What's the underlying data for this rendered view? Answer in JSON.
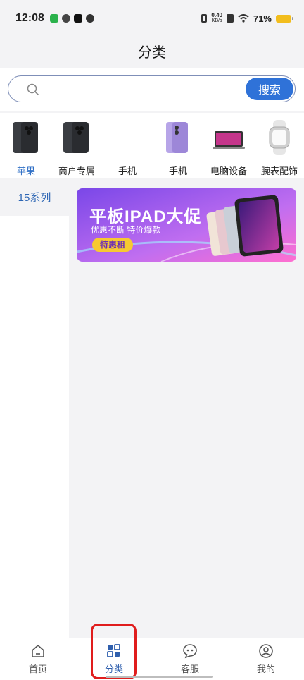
{
  "status_bar": {
    "time": "12:08",
    "net_speed_value": "0.40",
    "net_speed_unit": "KB/s",
    "battery": "71%",
    "icons": [
      "app-icon-green",
      "wechat-icon",
      "tiktok-icon",
      "link-icon",
      "vibrate-icon",
      "sim-icon",
      "wifi-icon",
      "battery-icon"
    ]
  },
  "header": {
    "title": "分类"
  },
  "search": {
    "placeholder": "",
    "value": "",
    "button_label": "搜索"
  },
  "categories": [
    {
      "label": "苹果",
      "icon": "iphone-pro-icon",
      "active": true
    },
    {
      "label": "商户专属",
      "icon": "iphone-pro-icon",
      "active": false
    },
    {
      "label": "手机",
      "icon": "blank",
      "active": false
    },
    {
      "label": "手机",
      "icon": "iphone-purple-icon",
      "active": false
    },
    {
      "label": "电脑设备",
      "icon": "laptop-icon",
      "active": false
    },
    {
      "label": "腕表配饰",
      "icon": "watch-icon",
      "active": false
    }
  ],
  "left_menu": {
    "items": [
      {
        "label": "15系列",
        "active": true
      }
    ]
  },
  "banner": {
    "title": "平板IPAD大促",
    "subtitle": "优惠不断 特价爆款",
    "badge": "特惠租",
    "colors": {
      "start": "#7a47e8",
      "end": "#ff6fd0",
      "badge": "#f7c932"
    }
  },
  "bottom_nav": {
    "items": [
      {
        "label": "首页",
        "icon": "home-icon",
        "active": false
      },
      {
        "label": "分类",
        "icon": "category-icon",
        "active": true
      },
      {
        "label": "客服",
        "icon": "chat-icon",
        "active": false
      },
      {
        "label": "我的",
        "icon": "profile-icon",
        "active": false
      }
    ]
  },
  "colors": {
    "accent": "#2f72d8",
    "active_text": "#2f6fc6",
    "highlight": "#e01d1d"
  }
}
